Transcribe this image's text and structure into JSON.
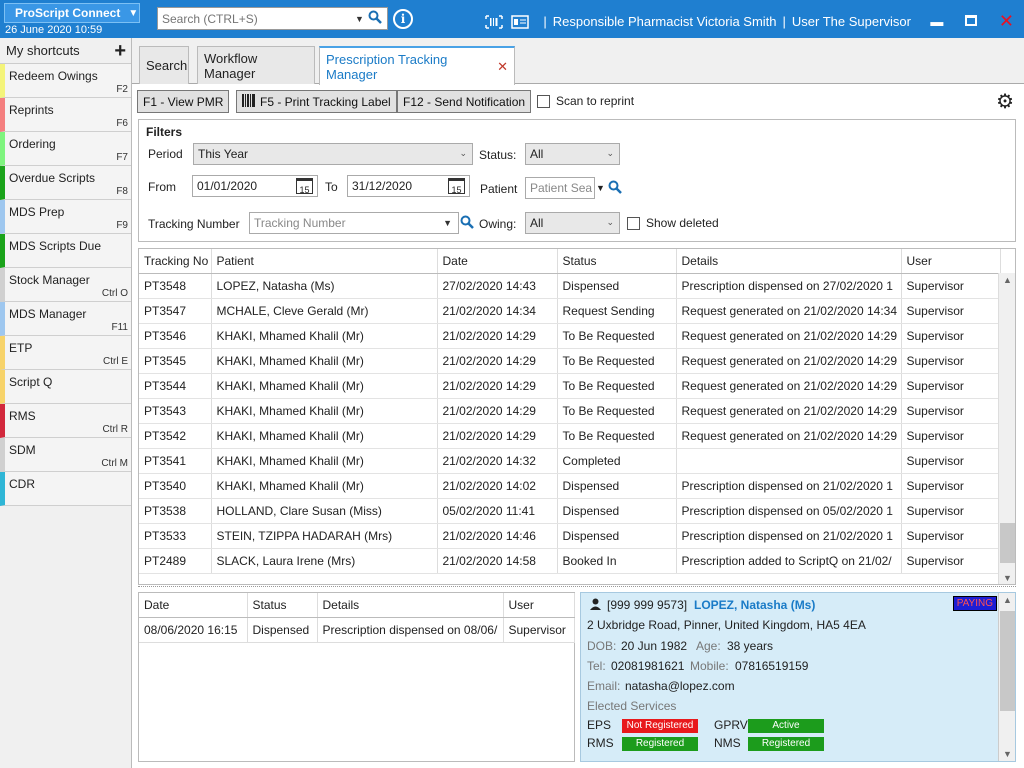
{
  "app": {
    "name": "ProScript Connect",
    "datetime": "26 June 2020 10:59",
    "search_placeholder": "Search (CTRL+S)",
    "pharmacist": "Responsible Pharmacist Victoria Smith",
    "user": "User The Supervisor",
    "colors": {
      "topbar": "#1f7fd0",
      "accent": "#1a7bc7"
    }
  },
  "sidebar": {
    "title": "My shortcuts",
    "items": [
      {
        "label": "Redeem Owings",
        "key": "F2",
        "color": "#f4f47a"
      },
      {
        "label": "Reprints",
        "key": "F6",
        "color": "#f47f7f"
      },
      {
        "label": "Ordering",
        "key": "F7",
        "color": "#7ef47e"
      },
      {
        "label": "Overdue Scripts",
        "key": "F8",
        "color": "#1aa31a"
      },
      {
        "label": "MDS Prep",
        "key": "F9",
        "color": "#9ec7ef"
      },
      {
        "label": "MDS Scripts Due",
        "key": "",
        "color": "#1aa31a"
      },
      {
        "label": "Stock Manager",
        "key": "Ctrl O",
        "color": "#d0d0d0"
      },
      {
        "label": "MDS Manager",
        "key": "F11",
        "color": "#9ec7ef"
      },
      {
        "label": "ETP",
        "key": "Ctrl E",
        "color": "#f7d36a"
      },
      {
        "label": "Script Q",
        "key": "",
        "color": "#f7d36a"
      },
      {
        "label": "RMS",
        "key": "Ctrl R",
        "color": "#d2283c"
      },
      {
        "label": "SDM",
        "key": "Ctrl M",
        "color": "#d0d0d0"
      },
      {
        "label": "CDR",
        "key": "",
        "color": "#2fb6d6"
      }
    ]
  },
  "tabs": [
    {
      "label": "Search"
    },
    {
      "label": "Workflow Manager"
    },
    {
      "label": "Prescription Tracking Manager",
      "active": true
    }
  ],
  "toolbar": {
    "view_pmr": "F1 - View PMR",
    "print_label": "F5 - Print Tracking Label",
    "send_notification": "F12 - Send Notification",
    "scan_to_reprint": "Scan to reprint"
  },
  "filters": {
    "title": "Filters",
    "period_label": "Period",
    "period_value": "This Year",
    "status_label": "Status:",
    "status_value": "All",
    "from_label": "From",
    "from_value": "01/01/2020",
    "to_label": "To",
    "to_value": "31/12/2020",
    "calendar_day": "15",
    "patient_label": "Patient",
    "patient_placeholder": "Patient Sea",
    "tracking_label": "Tracking Number",
    "tracking_placeholder": "Tracking Number",
    "owing_label": "Owing:",
    "owing_value": "All",
    "show_deleted": "Show deleted"
  },
  "grid": {
    "columns": [
      "Tracking No",
      "Patient",
      "Date",
      "Status",
      "Details",
      "User"
    ],
    "rows": [
      [
        "PT3548",
        "LOPEZ, Natasha (Ms)",
        "27/02/2020 14:43",
        "Dispensed",
        "Prescription dispensed on 27/02/2020 1",
        "Supervisor"
      ],
      [
        "PT3547",
        "MCHALE, Cleve Gerald (Mr)",
        "21/02/2020 14:34",
        "Request Sending",
        "Request generated on 21/02/2020 14:34",
        "Supervisor"
      ],
      [
        "PT3546",
        "KHAKI, Mhamed Khalil (Mr)",
        "21/02/2020 14:29",
        "To Be Requested",
        "Request generated on 21/02/2020 14:29",
        "Supervisor"
      ],
      [
        "PT3545",
        "KHAKI, Mhamed Khalil (Mr)",
        "21/02/2020 14:29",
        "To Be Requested",
        "Request generated on 21/02/2020 14:29",
        "Supervisor"
      ],
      [
        "PT3544",
        "KHAKI, Mhamed Khalil (Mr)",
        "21/02/2020 14:29",
        "To Be Requested",
        "Request generated on 21/02/2020 14:29",
        "Supervisor"
      ],
      [
        "PT3543",
        "KHAKI, Mhamed Khalil (Mr)",
        "21/02/2020 14:29",
        "To Be Requested",
        "Request generated on 21/02/2020 14:29",
        "Supervisor"
      ],
      [
        "PT3542",
        "KHAKI, Mhamed Khalil (Mr)",
        "21/02/2020 14:29",
        "To Be Requested",
        "Request generated on 21/02/2020 14:29",
        "Supervisor"
      ],
      [
        "PT3541",
        "KHAKI, Mhamed Khalil (Mr)",
        "21/02/2020 14:32",
        "Completed",
        "",
        "Supervisor"
      ],
      [
        "PT3540",
        "KHAKI, Mhamed Khalil (Mr)",
        "21/02/2020 14:02",
        "Dispensed",
        "Prescription dispensed on 21/02/2020 1",
        "Supervisor"
      ],
      [
        "PT3538",
        "HOLLAND, Clare Susan (Miss)",
        "05/02/2020 11:41",
        "Dispensed",
        "Prescription dispensed on 05/02/2020 1",
        "Supervisor"
      ],
      [
        "PT3533",
        "STEIN, TZIPPA HADARAH (Mrs)",
        "21/02/2020 14:46",
        "Dispensed",
        "Prescription dispensed on 21/02/2020 1",
        "Supervisor"
      ],
      [
        "PT2489",
        "SLACK, Laura Irene (Mrs)",
        "21/02/2020 14:58",
        "Booked In",
        "Prescription added to ScriptQ on 21/02/",
        "Supervisor"
      ]
    ]
  },
  "history": {
    "columns": [
      "Date",
      "Status",
      "Details",
      "User"
    ],
    "rows": [
      [
        "08/06/2020 16:15",
        "Dispensed",
        "Prescription dispensed on 08/06/",
        "Supervisor"
      ]
    ]
  },
  "patient": {
    "nhs": "[999 999 9573]",
    "name": "LOPEZ, Natasha (Ms)",
    "badge": "PAYING",
    "address": "2 Uxbridge Road, Pinner, United Kingdom, HA5 4EA",
    "dob_label": "DOB:",
    "dob": "20 Jun 1982",
    "age_label": "Age:",
    "age": "38 years",
    "tel_label": "Tel:",
    "tel": "02081981621",
    "mobile_label": "Mobile:",
    "mobile": "07816519159",
    "email_label": "Email:",
    "email": "natasha@lopez.com",
    "elected_label": "Elected Services",
    "services": [
      {
        "name": "EPS",
        "status": "Not Registered",
        "color": "#e8191c"
      },
      {
        "name": "GPRV",
        "status": "Active",
        "color": "#1c9c1c"
      },
      {
        "name": "RMS",
        "status": "Registered",
        "color": "#1c9c1c"
      },
      {
        "name": "NMS",
        "status": "Registered",
        "color": "#1c9c1c"
      }
    ]
  }
}
